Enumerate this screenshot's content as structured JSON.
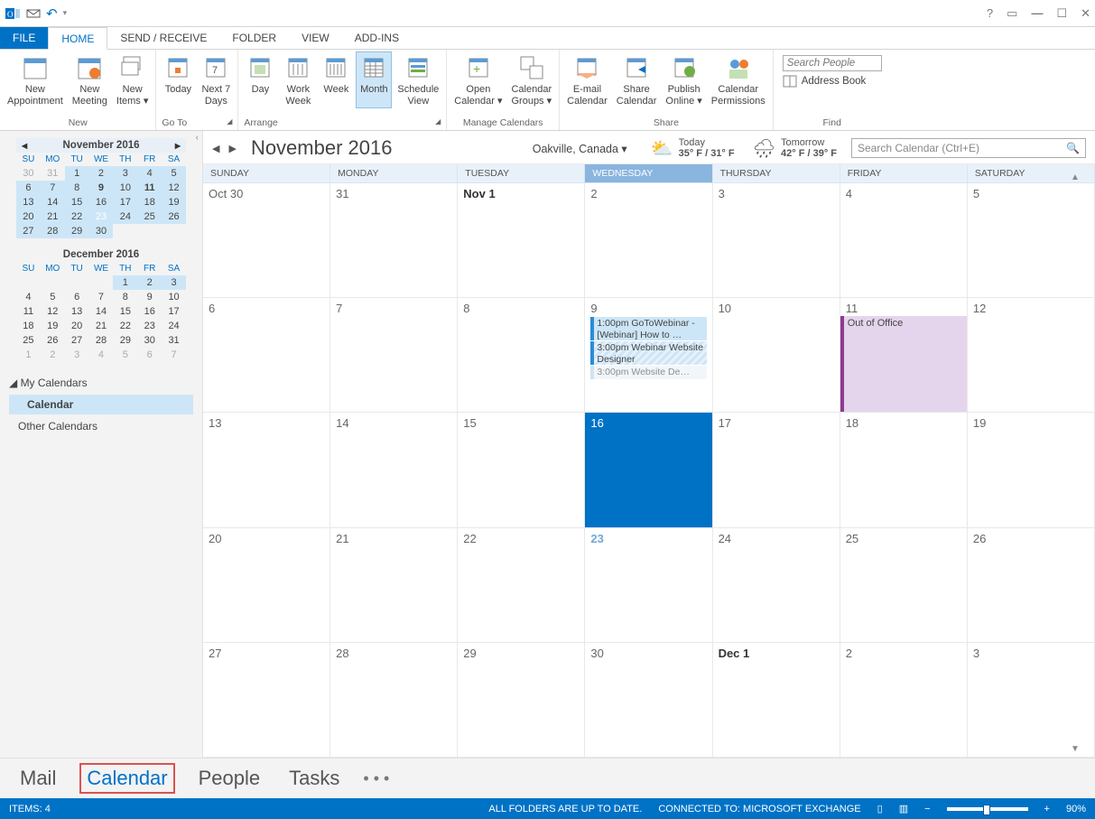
{
  "titlebar": {
    "app": "Outlook"
  },
  "ribbon_tabs": {
    "file": "FILE",
    "home": "HOME",
    "send": "SEND / RECEIVE",
    "folder": "FOLDER",
    "view": "VIEW",
    "addins": "ADD-INS"
  },
  "ribbon": {
    "groups": {
      "new": {
        "title": "New",
        "appointment": "New\nAppointment",
        "meeting": "New\nMeeting",
        "items": "New\nItems ▾"
      },
      "goto": {
        "title": "Go To",
        "today": "Today",
        "next7": "Next 7\nDays"
      },
      "arrange": {
        "title": "Arrange",
        "day": "Day",
        "workweek": "Work\nWeek",
        "week": "Week",
        "month": "Month",
        "schedule": "Schedule\nView"
      },
      "manage": {
        "title": "Manage Calendars",
        "open": "Open\nCalendar ▾",
        "groups": "Calendar\nGroups ▾"
      },
      "share": {
        "title": "Share",
        "email": "E-mail\nCalendar",
        "share": "Share\nCalendar",
        "publish": "Publish\nOnline ▾",
        "perm": "Calendar\nPermissions"
      },
      "find": {
        "title": "Find",
        "search_people_ph": "Search People",
        "address_book": "Address Book"
      }
    }
  },
  "sidebar": {
    "minical1": {
      "title": "November 2016",
      "dow": [
        "SU",
        "MO",
        "TU",
        "WE",
        "TH",
        "FR",
        "SA"
      ],
      "rows": [
        [
          {
            "d": "30",
            "dim": true
          },
          {
            "d": "31",
            "dim": true
          },
          {
            "d": "1"
          },
          {
            "d": "2"
          },
          {
            "d": "3"
          },
          {
            "d": "4"
          },
          {
            "d": "5"
          }
        ],
        [
          {
            "d": "6"
          },
          {
            "d": "7"
          },
          {
            "d": "8"
          },
          {
            "d": "9",
            "bold": true
          },
          {
            "d": "10"
          },
          {
            "d": "11",
            "bold": true
          },
          {
            "d": "12"
          }
        ],
        [
          {
            "d": "13"
          },
          {
            "d": "14"
          },
          {
            "d": "15"
          },
          {
            "d": "16"
          },
          {
            "d": "17"
          },
          {
            "d": "18"
          },
          {
            "d": "19"
          }
        ],
        [
          {
            "d": "20"
          },
          {
            "d": "21"
          },
          {
            "d": "22"
          },
          {
            "d": "23",
            "today": true
          },
          {
            "d": "24"
          },
          {
            "d": "25"
          },
          {
            "d": "26"
          }
        ],
        [
          {
            "d": "27"
          },
          {
            "d": "28"
          },
          {
            "d": "29"
          },
          {
            "d": "30"
          },
          {
            "d": "",
            "dim": true
          },
          {
            "d": "",
            "dim": true
          },
          {
            "d": "",
            "dim": true
          }
        ]
      ],
      "range_rows": [
        0,
        1,
        2,
        3,
        4
      ]
    },
    "minical2": {
      "title": "December 2016",
      "dow": [
        "SU",
        "MO",
        "TU",
        "WE",
        "TH",
        "FR",
        "SA"
      ],
      "rows": [
        [
          {
            "d": ""
          },
          {
            "d": ""
          },
          {
            "d": ""
          },
          {
            "d": ""
          },
          {
            "d": "1",
            "range": true
          },
          {
            "d": "2",
            "range": true
          },
          {
            "d": "3",
            "range": true
          }
        ],
        [
          {
            "d": "4"
          },
          {
            "d": "5"
          },
          {
            "d": "6"
          },
          {
            "d": "7"
          },
          {
            "d": "8"
          },
          {
            "d": "9"
          },
          {
            "d": "10"
          }
        ],
        [
          {
            "d": "11"
          },
          {
            "d": "12"
          },
          {
            "d": "13"
          },
          {
            "d": "14"
          },
          {
            "d": "15"
          },
          {
            "d": "16"
          },
          {
            "d": "17"
          }
        ],
        [
          {
            "d": "18"
          },
          {
            "d": "19"
          },
          {
            "d": "20"
          },
          {
            "d": "21"
          },
          {
            "d": "22"
          },
          {
            "d": "23"
          },
          {
            "d": "24"
          }
        ],
        [
          {
            "d": "25"
          },
          {
            "d": "26"
          },
          {
            "d": "27"
          },
          {
            "d": "28"
          },
          {
            "d": "29"
          },
          {
            "d": "30"
          },
          {
            "d": "31"
          }
        ],
        [
          {
            "d": "1",
            "dim": true
          },
          {
            "d": "2",
            "dim": true
          },
          {
            "d": "3",
            "dim": true
          },
          {
            "d": "4",
            "dim": true
          },
          {
            "d": "5",
            "dim": true
          },
          {
            "d": "6",
            "dim": true
          },
          {
            "d": "7",
            "dim": true
          }
        ]
      ]
    },
    "my_calendars": "My Calendars",
    "calendar_item": "Calendar",
    "other_calendars": "Other Calendars"
  },
  "content": {
    "month_title": "November 2016",
    "location": "Oakville, Canada",
    "weather": {
      "today": {
        "label": "Today",
        "temp": "35° F / 31° F"
      },
      "tomorrow": {
        "label": "Tomorrow",
        "temp": "42° F / 39° F"
      }
    },
    "search_placeholder": "Search Calendar (Ctrl+E)",
    "dow": [
      "SUNDAY",
      "MONDAY",
      "TUESDAY",
      "WEDNESDAY",
      "THURSDAY",
      "FRIDAY",
      "SATURDAY"
    ],
    "weeks": [
      [
        {
          "label": "Oct 30"
        },
        {
          "label": "31"
        },
        {
          "label": "Nov 1",
          "bold": true
        },
        {
          "label": "2"
        },
        {
          "label": "3"
        },
        {
          "label": "4"
        },
        {
          "label": "5"
        }
      ],
      [
        {
          "label": "6"
        },
        {
          "label": "7"
        },
        {
          "label": "8"
        },
        {
          "label": "9",
          "events": [
            {
              "text": "1:00pm GoToWebinar - [Webinar] How to …",
              "two": true
            },
            {
              "text": "3:00pm Webinar Website Designer",
              "two": true,
              "hatched": true
            },
            {
              "text": "3:00pm Website De…",
              "faded": true,
              "hatched": true
            }
          ]
        },
        {
          "label": "10"
        },
        {
          "label": "11",
          "allday": "Out of Office"
        },
        {
          "label": "12"
        }
      ],
      [
        {
          "label": "13"
        },
        {
          "label": "14"
        },
        {
          "label": "15"
        },
        {
          "label": "16",
          "today": true
        },
        {
          "label": "17"
        },
        {
          "label": "18"
        },
        {
          "label": "19"
        }
      ],
      [
        {
          "label": "20"
        },
        {
          "label": "21"
        },
        {
          "label": "22"
        },
        {
          "label": "23",
          "sel": true,
          "bold": true
        },
        {
          "label": "24"
        },
        {
          "label": "25"
        },
        {
          "label": "26"
        }
      ],
      [
        {
          "label": "27"
        },
        {
          "label": "28"
        },
        {
          "label": "29"
        },
        {
          "label": "30"
        },
        {
          "label": "Dec 1",
          "bold": true
        },
        {
          "label": "2"
        },
        {
          "label": "3"
        }
      ]
    ]
  },
  "bottom_nav": {
    "mail": "Mail",
    "calendar": "Calendar",
    "people": "People",
    "tasks": "Tasks"
  },
  "statusbar": {
    "items": "ITEMS: 4",
    "folders": "ALL FOLDERS ARE UP TO DATE.",
    "connected": "CONNECTED TO: MICROSOFT EXCHANGE",
    "zoom": "90%"
  }
}
